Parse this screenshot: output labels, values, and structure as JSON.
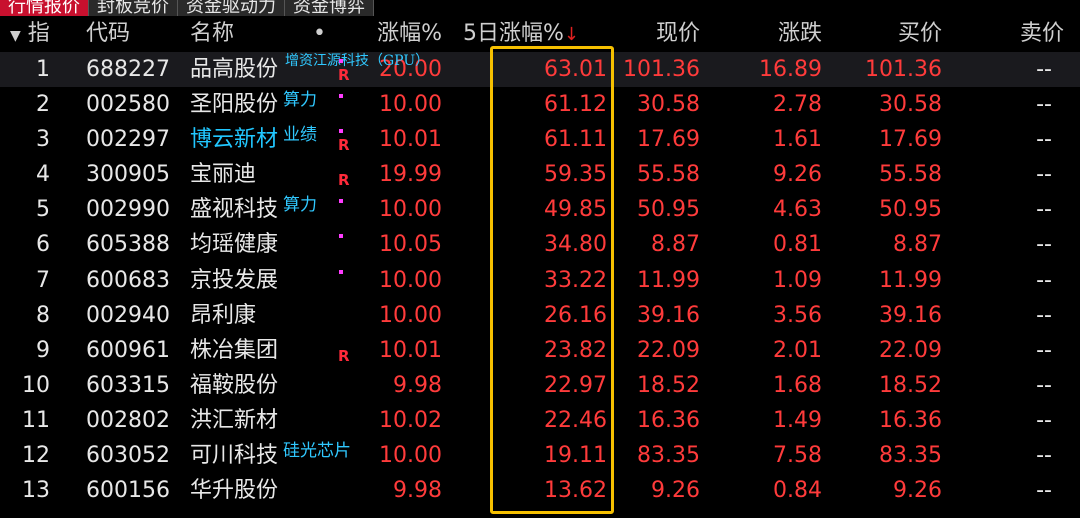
{
  "tabs": [
    "行情报价",
    "封板竞价",
    "资金驱动力",
    "资金博弈"
  ],
  "header": {
    "index": "指",
    "code": "代码",
    "name": "名称",
    "dot": "•",
    "change_pct": "涨幅%",
    "five_day_pct": "5日涨幅%",
    "sort_arrow": "↓",
    "price": "现价",
    "change": "涨跌",
    "bid": "买价",
    "ask": "卖价"
  },
  "rows": [
    {
      "idx": "1",
      "code": "688227",
      "name": "品高股份",
      "tag": "增资江源科技（GPU）",
      "pct": "20.00",
      "pct5": "63.01",
      "price": "101.36",
      "chg": "16.89",
      "bid": "101.36",
      "ask": "--"
    },
    {
      "idx": "2",
      "code": "002580",
      "name": "圣阳股份",
      "tag": "算力",
      "pct": "10.00",
      "pct5": "61.12",
      "price": "30.58",
      "chg": "2.78",
      "bid": "30.58",
      "ask": "--"
    },
    {
      "idx": "3",
      "code": "002297",
      "name": "博云新材",
      "tag": "业绩",
      "pct": "10.01",
      "pct5": "61.11",
      "price": "17.69",
      "chg": "1.61",
      "bid": "17.69",
      "ask": "--"
    },
    {
      "idx": "4",
      "code": "300905",
      "name": "宝丽迪",
      "tag": "",
      "pct": "19.99",
      "pct5": "59.35",
      "price": "55.58",
      "chg": "9.26",
      "bid": "55.58",
      "ask": "--"
    },
    {
      "idx": "5",
      "code": "002990",
      "name": "盛视科技",
      "tag": "算力",
      "pct": "10.00",
      "pct5": "49.85",
      "price": "50.95",
      "chg": "4.63",
      "bid": "50.95",
      "ask": "--"
    },
    {
      "idx": "6",
      "code": "605388",
      "name": "均瑶健康",
      "tag": "",
      "pct": "10.05",
      "pct5": "34.80",
      "price": "8.87",
      "chg": "0.81",
      "bid": "8.87",
      "ask": "--"
    },
    {
      "idx": "7",
      "code": "600683",
      "name": "京投发展",
      "tag": "",
      "pct": "10.00",
      "pct5": "33.22",
      "price": "11.99",
      "chg": "1.09",
      "bid": "11.99",
      "ask": "--"
    },
    {
      "idx": "8",
      "code": "002940",
      "name": "昂利康",
      "tag": "",
      "pct": "10.00",
      "pct5": "26.16",
      "price": "39.16",
      "chg": "3.56",
      "bid": "39.16",
      "ask": "--"
    },
    {
      "idx": "9",
      "code": "600961",
      "name": "株冶集团",
      "tag": "",
      "pct": "10.01",
      "pct5": "23.82",
      "price": "22.09",
      "chg": "2.01",
      "bid": "22.09",
      "ask": "--"
    },
    {
      "idx": "10",
      "code": "603315",
      "name": "福鞍股份",
      "tag": "",
      "pct": "9.98",
      "pct5": "22.97",
      "price": "18.52",
      "chg": "1.68",
      "bid": "18.52",
      "ask": "--"
    },
    {
      "idx": "11",
      "code": "002802",
      "name": "洪汇新材",
      "tag": "",
      "pct": "10.02",
      "pct5": "22.46",
      "price": "16.36",
      "chg": "1.49",
      "bid": "16.36",
      "ask": "--"
    },
    {
      "idx": "12",
      "code": "603052",
      "name": "可川科技",
      "tag": "硅光芯片",
      "pct": "10.00",
      "pct5": "19.11",
      "price": "83.35",
      "chg": "7.58",
      "bid": "83.35",
      "ask": "--"
    },
    {
      "idx": "13",
      "code": "600156",
      "name": "华升股份",
      "tag": "",
      "pct": "9.98",
      "pct5": "13.62",
      "price": "9.26",
      "chg": "0.84",
      "bid": "9.26",
      "ask": "--"
    }
  ],
  "marks": {
    "r_label": "R"
  },
  "colors": {
    "up": "#ff3b3b",
    "accent_box": "#f6c000",
    "tag": "#30c8ff",
    "highlight_name": "#21c7ff"
  }
}
